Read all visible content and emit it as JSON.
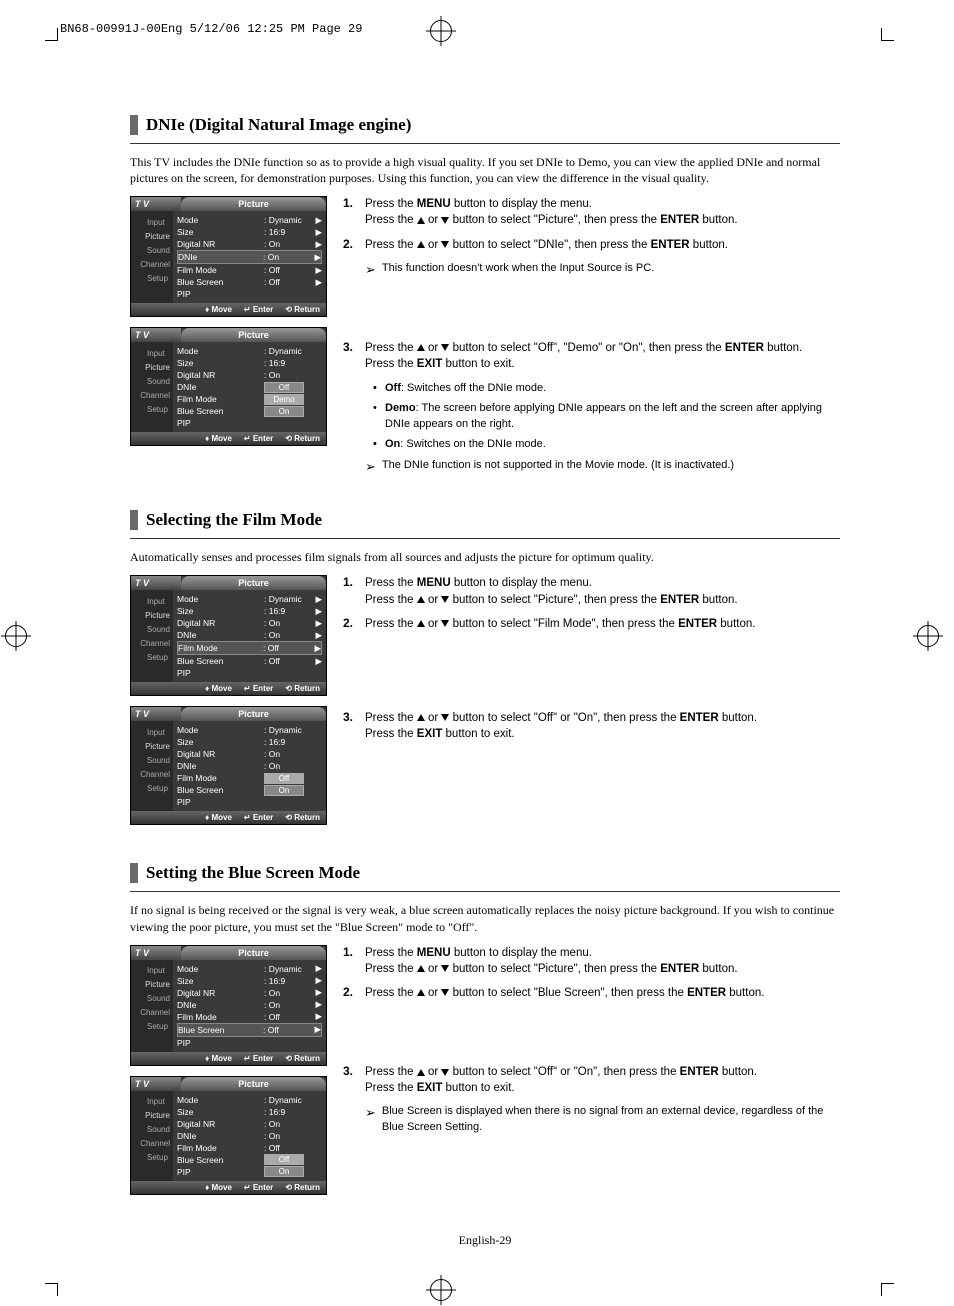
{
  "slug": "BN68-00991J-00Eng  5/12/06  12:25 PM  Page 29",
  "page_footer": "English-29",
  "sections": [
    {
      "title": "DNIe (Digital Natural Image engine)",
      "intro": "This TV includes the DNIe function so as to provide a high visual quality. If you set DNIe to Demo, you can view the applied DNIe and normal pictures on the screen, for demonstration purposes. Using this function, you can view the difference in the visual quality.",
      "osd": [
        {
          "tv": "T V",
          "title": "Picture",
          "sidebar": [
            "Input",
            "Picture",
            "Sound",
            "Channel",
            "Setup"
          ],
          "rows": [
            {
              "l": "Mode",
              "v": ": Dynamic",
              "a": "▶"
            },
            {
              "l": "Size",
              "v": ": 16:9",
              "a": "▶"
            },
            {
              "l": "Digital NR",
              "v": ": On",
              "a": "▶"
            },
            {
              "l": "DNIe",
              "v": ": On",
              "a": "▶",
              "hl": true
            },
            {
              "l": "Film Mode",
              "v": ": Off",
              "a": "▶"
            },
            {
              "l": "Blue Screen",
              "v": ": Off",
              "a": "▶"
            },
            {
              "l": "PIP",
              "v": "",
              "a": ""
            }
          ],
          "foot": [
            "Move",
            "Enter",
            "Return"
          ]
        },
        {
          "tv": "T V",
          "title": "Picture",
          "sidebar": [
            "Input",
            "Picture",
            "Sound",
            "Channel",
            "Setup"
          ],
          "rows": [
            {
              "l": "Mode",
              "v": ": Dynamic",
              "a": ""
            },
            {
              "l": "Size",
              "v": ": 16:9",
              "a": ""
            },
            {
              "l": "Digital NR",
              "v": ": On",
              "a": ""
            },
            {
              "l": "DNIe",
              "vb": "Off",
              "a": ""
            },
            {
              "l": "Film Mode",
              "vb": "Demo",
              "a": "",
              "hlv": true
            },
            {
              "l": "Blue Screen",
              "vb": "On",
              "a": ""
            },
            {
              "l": "PIP",
              "v": "",
              "a": ""
            }
          ],
          "foot": [
            "Move",
            "Enter",
            "Return"
          ]
        }
      ],
      "steps": [
        {
          "n": "1.",
          "lines": [
            "Press the <b>MENU</b> button to display the menu.",
            "Press the ▲ or ▼ button to select \"Picture\", then press the <b>ENTER</b> button."
          ]
        },
        {
          "n": "2.",
          "lines": [
            "Press the ▲ or ▼ button to select \"DNIe\", then press the <b>ENTER</b> button."
          ],
          "note": "This function doesn't work when the Input Source is PC."
        },
        {
          "n": "3.",
          "lines": [
            "Press the ▲ or ▼ button to select \"Off\", \"Demo\" or \"On\", then press the <b>ENTER</b> button.",
            "Press the <b>EXIT</b> button to exit."
          ],
          "bullets": [
            "<b>Off</b>: Switches off the DNIe mode.",
            "<b>Demo</b>: The screen before applying DNIe appears on the left and the screen after applying DNIe appears on the right.",
            "<b>On</b>: Switches on the DNIe mode."
          ],
          "note2": "The DNIe function is not supported in the Movie mode. (It is inactivated.)"
        }
      ]
    },
    {
      "title": "Selecting the Film Mode",
      "intro": "Automatically senses and processes film signals from all sources and adjusts the picture for optimum quality.",
      "osd": [
        {
          "tv": "T V",
          "title": "Picture",
          "sidebar": [
            "Input",
            "Picture",
            "Sound",
            "Channel",
            "Setup"
          ],
          "rows": [
            {
              "l": "Mode",
              "v": ": Dynamic",
              "a": "▶"
            },
            {
              "l": "Size",
              "v": ": 16:9",
              "a": "▶"
            },
            {
              "l": "Digital NR",
              "v": ": On",
              "a": "▶"
            },
            {
              "l": "DNIe",
              "v": ": On",
              "a": "▶"
            },
            {
              "l": "Film Mode",
              "v": ": Off",
              "a": "▶",
              "hl": true
            },
            {
              "l": "Blue Screen",
              "v": ": Off",
              "a": "▶"
            },
            {
              "l": "PIP",
              "v": "",
              "a": ""
            }
          ],
          "foot": [
            "Move",
            "Enter",
            "Return"
          ]
        },
        {
          "tv": "T V",
          "title": "Picture",
          "sidebar": [
            "Input",
            "Picture",
            "Sound",
            "Channel",
            "Setup"
          ],
          "rows": [
            {
              "l": "Mode",
              "v": ": Dynamic",
              "a": ""
            },
            {
              "l": "Size",
              "v": ": 16:9",
              "a": ""
            },
            {
              "l": "Digital NR",
              "v": ": On",
              "a": ""
            },
            {
              "l": "DNIe",
              "v": ": On",
              "a": ""
            },
            {
              "l": "Film Mode",
              "vb": "Off",
              "a": "",
              "hlv": true
            },
            {
              "l": "Blue Screen",
              "vb": "On",
              "a": ""
            },
            {
              "l": "PIP",
              "v": "",
              "a": ""
            }
          ],
          "foot": [
            "Move",
            "Enter",
            "Return"
          ]
        }
      ],
      "steps": [
        {
          "n": "1.",
          "lines": [
            "Press the <b>MENU</b> button to display the menu.",
            "Press the ▲ or ▼ button to select \"Picture\", then press the <b>ENTER</b> button."
          ]
        },
        {
          "n": "2.",
          "lines": [
            "Press the ▲ or ▼ button to select \"Film Mode\", then press the <b>ENTER</b> button."
          ]
        },
        {
          "n": "3.",
          "lines": [
            "Press the ▲ or ▼ button to select \"Off\" or \"On\", then press the <b>ENTER</b> button.",
            "Press the <b>EXIT</b> button to exit."
          ]
        }
      ]
    },
    {
      "title": "Setting the Blue Screen Mode",
      "intro": "If no signal is being received or the signal is very weak, a blue screen automatically replaces the noisy picture background. If you wish to continue viewing the poor picture, you must set the \"Blue Screen\" mode to \"Off\".",
      "osd": [
        {
          "tv": "T V",
          "title": "Picture",
          "sidebar": [
            "Input",
            "Picture",
            "Sound",
            "Channel",
            "Setup"
          ],
          "rows": [
            {
              "l": "Mode",
              "v": ": Dynamic",
              "a": "▶"
            },
            {
              "l": "Size",
              "v": ": 16:9",
              "a": "▶"
            },
            {
              "l": "Digital NR",
              "v": ": On",
              "a": "▶"
            },
            {
              "l": "DNIe",
              "v": ": On",
              "a": "▶"
            },
            {
              "l": "Film Mode",
              "v": ": Off",
              "a": "▶"
            },
            {
              "l": "Blue Screen",
              "v": ": Off",
              "a": "▶",
              "hl": true
            },
            {
              "l": "PIP",
              "v": "",
              "a": ""
            }
          ],
          "foot": [
            "Move",
            "Enter",
            "Return"
          ]
        },
        {
          "tv": "T V",
          "title": "Picture",
          "sidebar": [
            "Input",
            "Picture",
            "Sound",
            "Channel",
            "Setup"
          ],
          "rows": [
            {
              "l": "Mode",
              "v": ": Dynamic",
              "a": ""
            },
            {
              "l": "Size",
              "v": ": 16:9",
              "a": ""
            },
            {
              "l": "Digital NR",
              "v": ": On",
              "a": ""
            },
            {
              "l": "DNIe",
              "v": ": On",
              "a": ""
            },
            {
              "l": "Film Mode",
              "v": ": Off",
              "a": ""
            },
            {
              "l": "Blue Screen",
              "vb": "Off",
              "a": "",
              "hlv": true
            },
            {
              "l": "PIP",
              "vb": "On",
              "a": ""
            }
          ],
          "foot": [
            "Move",
            "Enter",
            "Return"
          ]
        }
      ],
      "steps": [
        {
          "n": "1.",
          "lines": [
            "Press the <b>MENU</b> button to display the menu.",
            "Press the ▲ or ▼ button to select \"Picture\", then press the <b>ENTER</b> button."
          ]
        },
        {
          "n": "2.",
          "lines": [
            "Press the ▲ or ▼ button to select \"Blue Screen\", then press the <b>ENTER</b> button."
          ]
        },
        {
          "n": "3.",
          "lines": [
            "Press the ▲ or ▼ button to select \"Off\" or \"On\", then press the <b>ENTER</b> button.",
            "Press the <b>EXIT</b> button to exit."
          ],
          "note": "Blue Screen is displayed when there is no signal from an external device, regardless of the Blue Screen Setting."
        }
      ]
    }
  ]
}
